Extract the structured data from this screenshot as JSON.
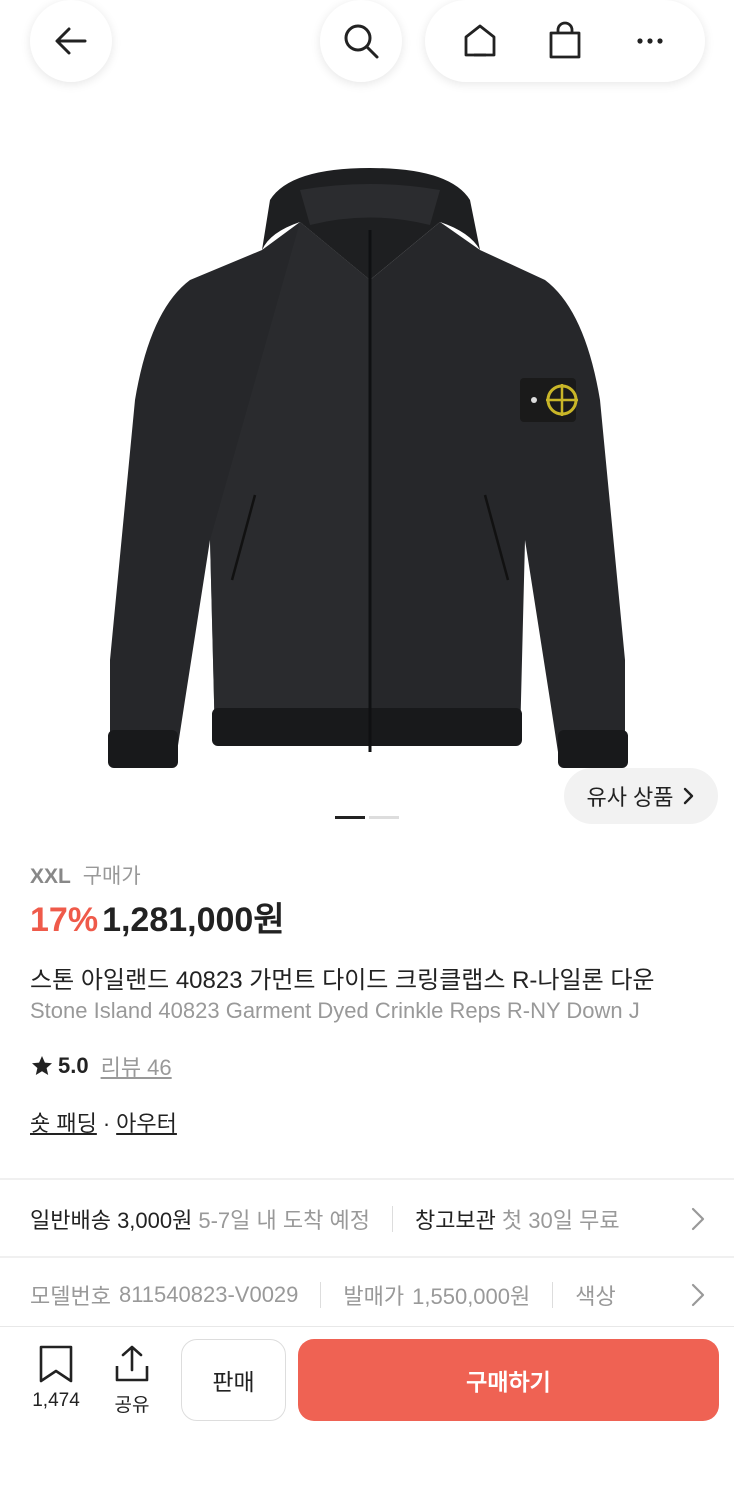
{
  "product": {
    "size": "XXL",
    "size_label": "구매가",
    "discount": "17%",
    "price": "1,281,000원",
    "name_ko": "스톤 아일랜드 40823 가먼트 다이드 크링클랩스 R-나일론 다운",
    "name_en": "Stone Island 40823 Garment Dyed Crinkle Reps R-NY Down J",
    "rating": "5.0",
    "review_label": "리뷰 46",
    "category_1": "숏 패딩",
    "category_sep": "·",
    "category_2": "아우터",
    "similar_label": "유사 상품",
    "image_count": 2,
    "image_index": 1
  },
  "shipping": {
    "method": "일반배송 3,000원",
    "eta": "5-7일 내 도착 예정",
    "storage": "창고보관",
    "storage_note": "첫 30일 무료"
  },
  "details": {
    "model_label": "모델번호",
    "model_value": "811540823-V0029",
    "release_label": "발매가",
    "release_value": "1,550,000원",
    "color_label": "색상"
  },
  "bottom": {
    "save_count": "1,474",
    "share_label": "공유",
    "sell_label": "판매",
    "buy_label": "구매하기"
  },
  "colors": {
    "accent": "#ef6253",
    "discount": "#ef5a4a",
    "text": "#222222",
    "muted": "#999999"
  },
  "icons": [
    "back-arrow-icon",
    "search-icon",
    "home-icon",
    "shopping-bag-icon",
    "more-icon",
    "chevron-right-icon",
    "star-icon",
    "bookmark-icon",
    "share-icon"
  ]
}
